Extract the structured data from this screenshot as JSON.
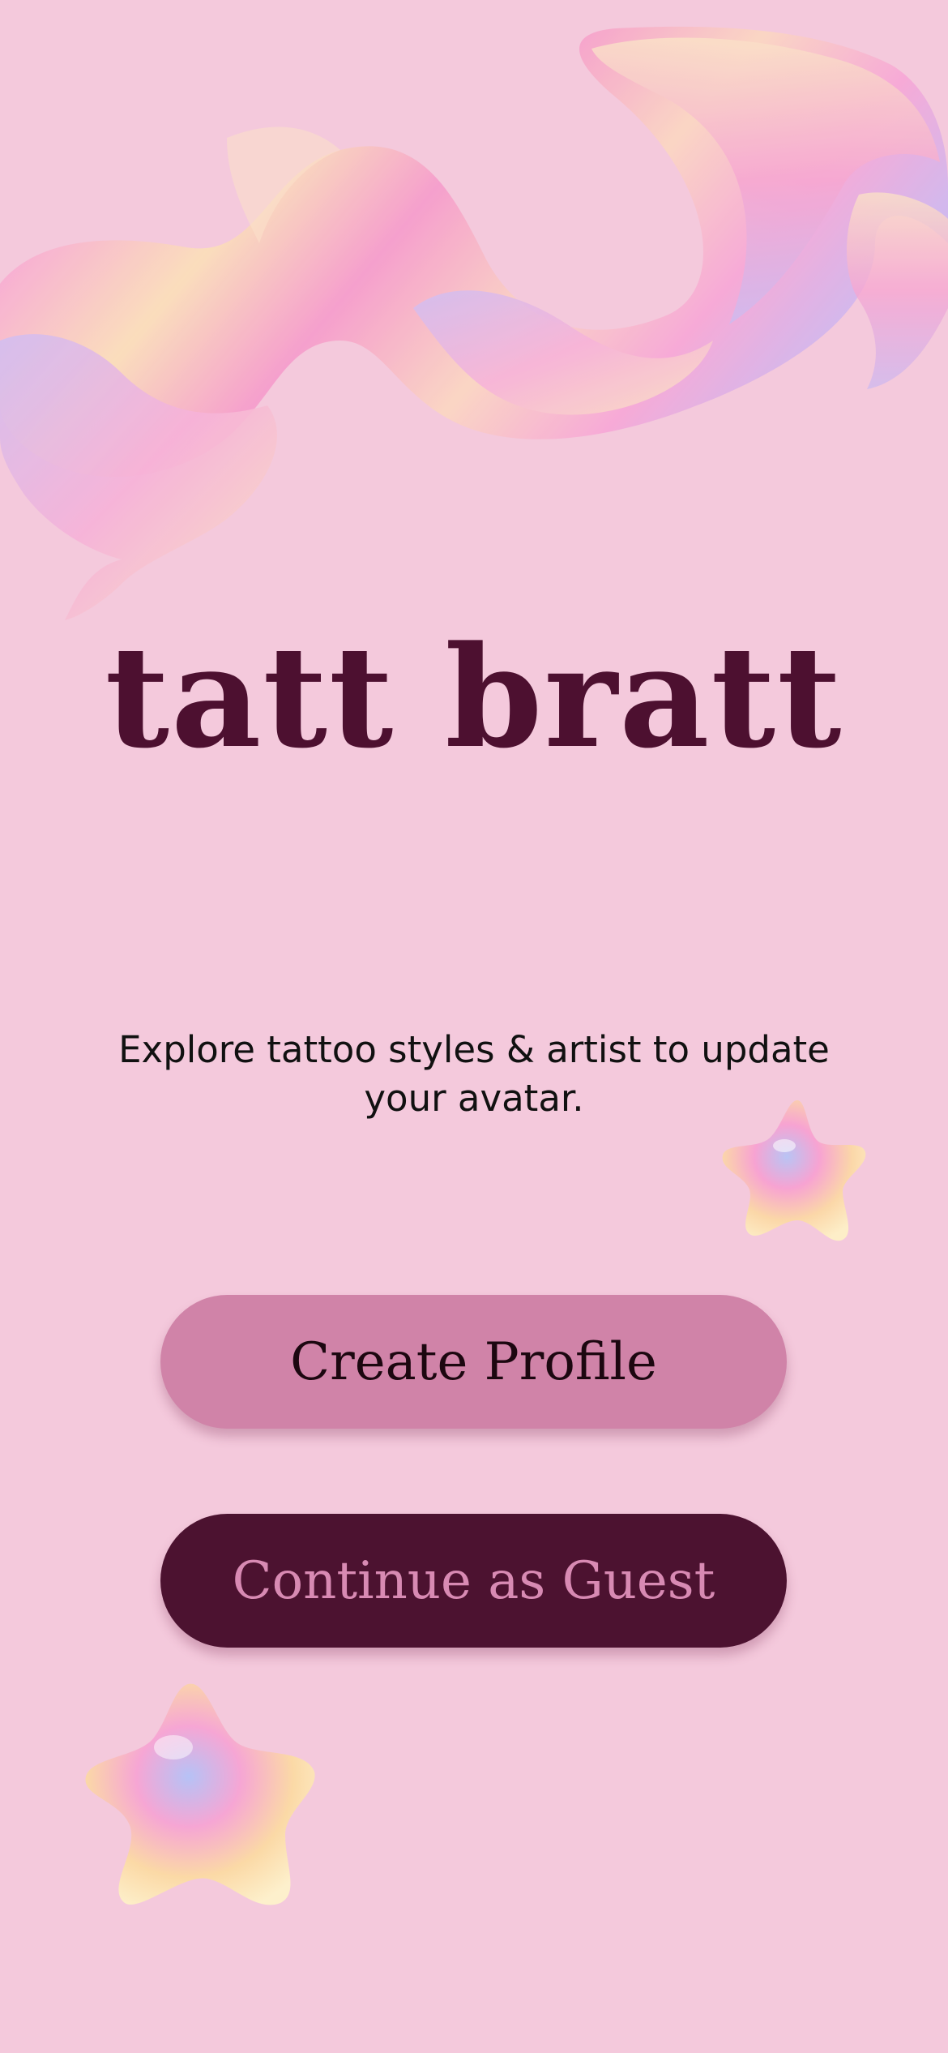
{
  "app": {
    "title": "tatt bratt",
    "tagline": "Explore tattoo styles & artist to update your avatar."
  },
  "actions": {
    "create_profile_label": "Create Profile",
    "continue_guest_label": "Continue as Guest"
  },
  "decorations": {
    "ribbon": "holographic-ribbon",
    "stars": [
      "holographic-star",
      "holographic-star"
    ]
  },
  "colors": {
    "background": "#f4c9dc",
    "brand_dark": "#4d1030",
    "button_primary": "#d083a8",
    "button_secondary": "#4c1230",
    "guest_text": "#d88ab3"
  }
}
